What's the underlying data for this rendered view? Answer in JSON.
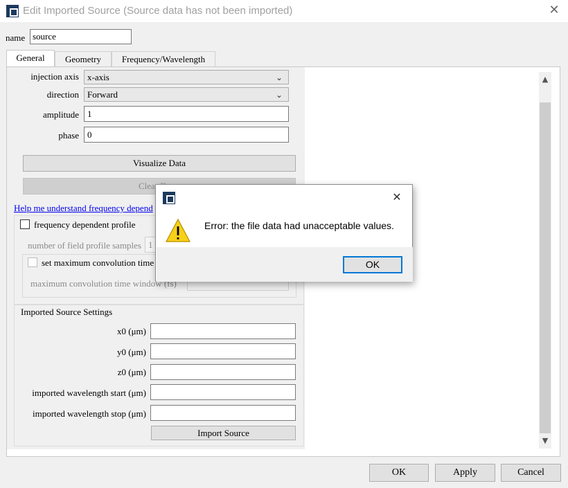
{
  "window": {
    "title": "Edit Imported Source (Source data has not been imported)",
    "close_glyph": "✕"
  },
  "name_field": {
    "label": "name",
    "value": "source"
  },
  "tabs": [
    {
      "label": "General",
      "active": true
    },
    {
      "label": "Geometry",
      "active": false
    },
    {
      "label": "Frequency/Wavelength",
      "active": false
    }
  ],
  "general": {
    "injection_axis": {
      "label": "injection axis",
      "value": "x-axis"
    },
    "direction": {
      "label": "direction",
      "value": "Forward"
    },
    "amplitude": {
      "label": "amplitude",
      "value": "1"
    },
    "phase": {
      "label": "phase",
      "value": "0"
    },
    "visualize_button": "Visualize Data",
    "clear_button": "Clear Da",
    "help_link": "Help me understand frequency depend",
    "freq_profile_label": "frequency dependent profile",
    "field_samples": {
      "label": "number of field profile samples",
      "value": "1"
    },
    "set_max_conv_label": "set maximum convolution time",
    "max_conv_window_label": "maximum convolution time window (fs)"
  },
  "imported_settings": {
    "title": "Imported Source Settings",
    "fields": [
      {
        "label": "x0 (μm)",
        "value": ""
      },
      {
        "label": "y0 (μm)",
        "value": ""
      },
      {
        "label": "z0 (μm)",
        "value": ""
      },
      {
        "label": "imported wavelength start (μm)",
        "value": ""
      },
      {
        "label": "imported wavelength stop (μm)",
        "value": ""
      }
    ],
    "import_button": "Import Source"
  },
  "footer": {
    "ok": "OK",
    "apply": "Apply",
    "cancel": "Cancel"
  },
  "error_dialog": {
    "message": "Error: the file data had unacceptable values.",
    "ok_label": "OK",
    "warning_glyph": "!",
    "close_glyph": "✕"
  },
  "icons": {
    "app": "app-icon",
    "warning": "warning-icon",
    "chevron": "chevron-down-icon"
  },
  "colors": {
    "dialog_ok_border": "#0078d7",
    "warning_fill": "#f7d117",
    "link": "#0000ee"
  }
}
